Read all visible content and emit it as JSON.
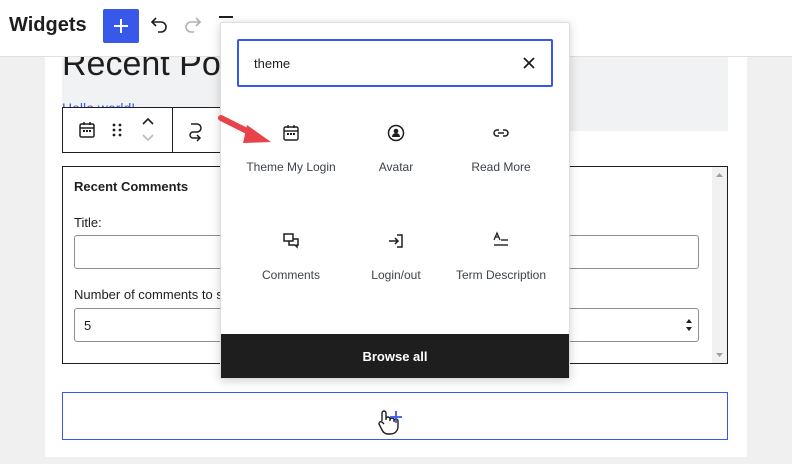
{
  "header": {
    "title": "Widgets",
    "add_block_icon": "plus-icon",
    "undo_icon": "undo-icon",
    "redo_icon": "redo-icon"
  },
  "editor": {
    "heading_text": "Recent Posts",
    "heading_subtext": "Hello world!",
    "block_toolbar": {
      "icons": [
        "calendar-icon",
        "drag-handle-icon",
        "move-up-icon",
        "move-down-icon",
        "transform-icon"
      ]
    },
    "recent_comments": {
      "title": "Recent Comments",
      "title_label": "Title:",
      "title_value": "",
      "number_label": "Number of comments to show:",
      "number_value": "5"
    }
  },
  "inserter": {
    "search": {
      "value": "theme",
      "clear_icon": "close-icon"
    },
    "blocks": [
      {
        "label": "Theme My Login",
        "icon": "calendar-icon"
      },
      {
        "label": "Avatar",
        "icon": "avatar-icon"
      },
      {
        "label": "Read More",
        "icon": "link-icon"
      },
      {
        "label": "Comments",
        "icon": "comments-icon"
      },
      {
        "label": "Login/out",
        "icon": "login-icon"
      },
      {
        "label": "Term Description",
        "icon": "term-description-icon"
      }
    ],
    "browse_all_label": "Browse all"
  },
  "colors": {
    "accent": "#3858e9",
    "arrow": "#e8434c",
    "dark": "#1e1e1e"
  }
}
